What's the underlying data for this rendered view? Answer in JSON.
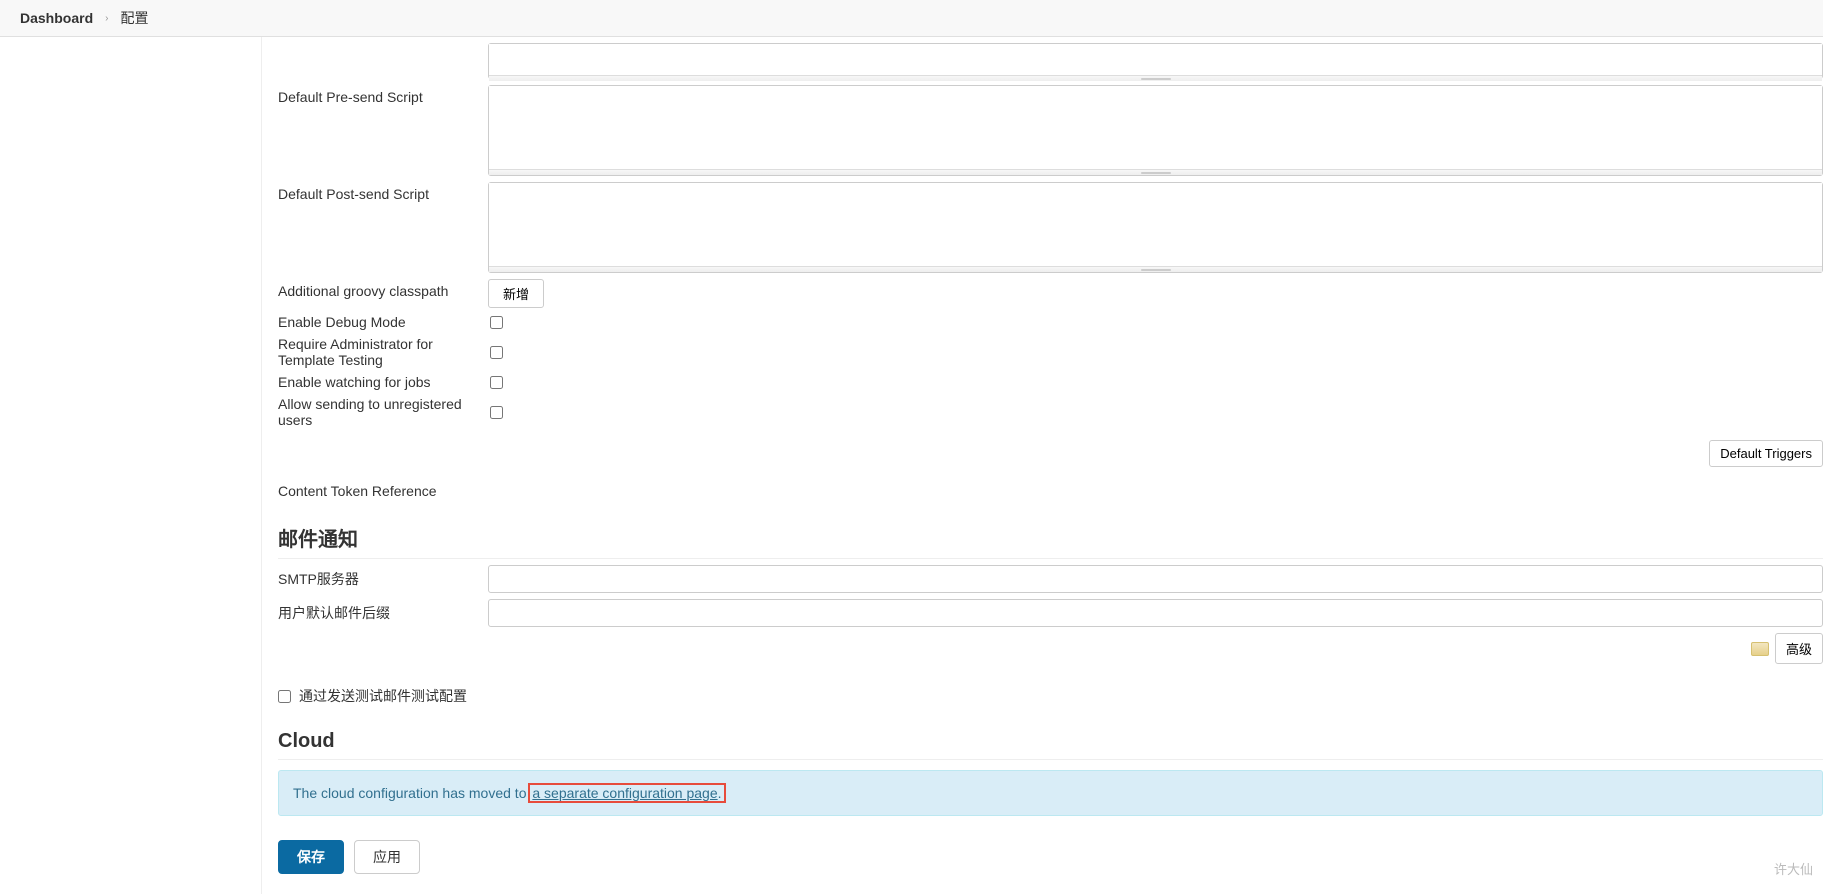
{
  "breadcrumb": {
    "root": "Dashboard",
    "current": "配置"
  },
  "form": {
    "pre_send_label": "Default Pre-send Script",
    "post_send_label": "Default Post-send Script",
    "groovy_label": "Additional groovy classpath",
    "groovy_add_btn": "新增",
    "debug_label": "Enable Debug Mode",
    "require_admin_label": "Require Administrator for Template Testing",
    "watch_jobs_label": "Enable watching for jobs",
    "allow_unreg_label": "Allow sending to unregistered users",
    "default_triggers_btn": "Default Triggers",
    "content_token_label": "Content Token Reference"
  },
  "mail": {
    "heading": "邮件通知",
    "smtp_label": "SMTP服务器",
    "suffix_label": "用户默认邮件后缀",
    "advanced_btn": "高级",
    "test_label": "通过发送测试邮件测试配置"
  },
  "cloud": {
    "heading": "Cloud",
    "msg_prefix": "The cloud configuration has moved to ",
    "link": "a separate configuration page",
    "msg_suffix": "."
  },
  "actions": {
    "save": "保存",
    "apply": "应用"
  },
  "watermark": "许大仙"
}
